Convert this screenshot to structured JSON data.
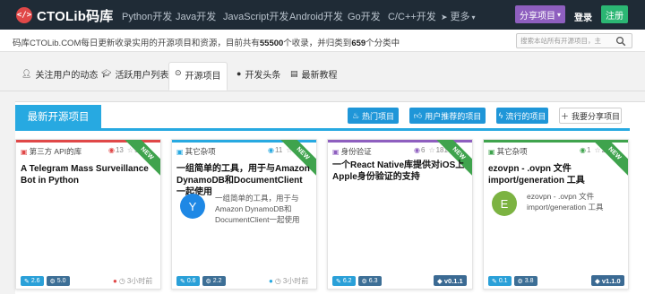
{
  "nav": {
    "brand": "CTOLib码库",
    "brand_logo": "</>",
    "links": [
      "Python开发",
      "Java开发",
      "JavaScript开发",
      "Android开发",
      "Go开发",
      "C/C++开发"
    ],
    "more_label": "更多",
    "share_label": "分享项目",
    "login_label": "登录",
    "register_label": "注册"
  },
  "info": {
    "prefix": "码库CTOLib.COM每日更新收录实用的开源项目和资源，目前共有",
    "project_count": "55500",
    "middle": "个收录，并归类到",
    "category_count": "659",
    "suffix": "个分类中",
    "search_placeholder": "搜索本站所有开源项目，主"
  },
  "tabs": [
    {
      "label": "关注用户的动态",
      "icon": "user-icon"
    },
    {
      "label": "活跃用户列表",
      "icon": "graduation-cap-icon"
    },
    {
      "label": "开源项目",
      "icon": "dot-circle-icon",
      "active": true
    },
    {
      "label": "开发头条",
      "icon": "globe-icon"
    },
    {
      "label": "最新教程",
      "icon": "newspaper-icon"
    }
  ],
  "panel": {
    "title": "最新开源项目",
    "buttons": [
      {
        "label": "热门项目",
        "icon": "fire-icon"
      },
      {
        "label": "用户推荐的项目",
        "icon": "thumbs-up-icon"
      },
      {
        "label": "流行的项目",
        "icon": "bolt-icon"
      },
      {
        "label": "我要分享项目",
        "icon": "plus-icon"
      }
    ]
  },
  "cards": [
    {
      "category": "第三方 API的库",
      "category_color": "#e04848",
      "views": "13",
      "stars": "543",
      "ribbon": "NEW",
      "title": "A Telegram Mass Surveillance Bot in Python",
      "badge1": "2.6",
      "badge2": "5.0",
      "time": "3小时前",
      "time_icon_color": "#e04848"
    },
    {
      "category": "其它杂项",
      "category_color": "#27a9e1",
      "views": "11",
      "stars": "184",
      "ribbon": "NEW",
      "title": "一组简单的工具，用于与Amazon DynamoDB和DocumentClient一起使用",
      "avatar": "Y",
      "avatar_color": "#1e88e5",
      "desc": "一组简单的工具，用于与Amazon DynamoDB和DocumentClient一起使用",
      "badge1": "0.6",
      "badge2": "2.2",
      "time": "3小时前",
      "time_icon_color": "#27a9e1"
    },
    {
      "category": "身份验证",
      "category_color": "#8e5fbf",
      "views": "6",
      "stars": "181",
      "ribbon": "NEW",
      "title": "一个React Native库提供对iOS上Apple身份验证的支持",
      "badge1": "6.2",
      "badge2": "6.3",
      "version": "v0.1.1"
    },
    {
      "category": "其它杂项",
      "category_color": "#3fa34d",
      "views": "1",
      "stars": "27",
      "ribbon": "NEW",
      "title": "ezovpn - .ovpn 文件 import/generation 工具",
      "avatar": "E",
      "avatar_color": "#7cb342",
      "desc": "ezovpn - .ovpn 文件 import/generation 工具",
      "badge1": "0.1",
      "badge2": "3.8",
      "version": "v1.1.0"
    }
  ]
}
